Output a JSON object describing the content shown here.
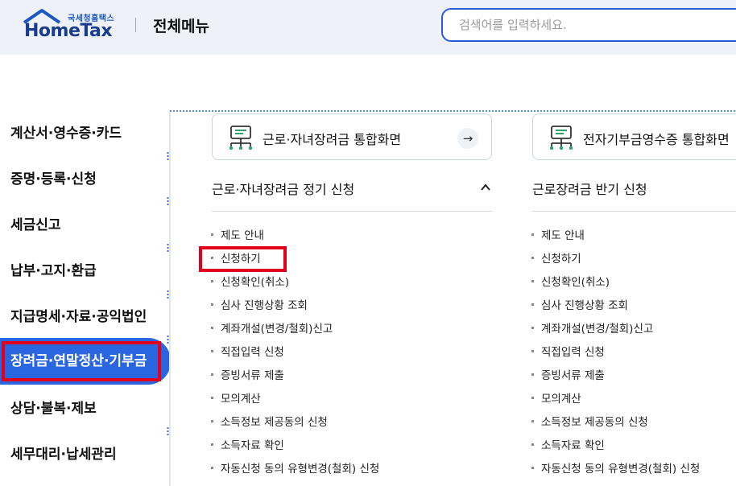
{
  "header": {
    "logo_small": "국세청홈택스",
    "logo_big": "HomeTax",
    "title": "전체메뉴",
    "search_placeholder": "검색어를 입력하세요."
  },
  "sidebar": {
    "items": [
      {
        "label": "계산서·영수증·카드",
        "active": false
      },
      {
        "label": "증명·등록·신청",
        "active": false
      },
      {
        "label": "세금신고",
        "active": false
      },
      {
        "label": "납부·고지·환급",
        "active": false
      },
      {
        "label": "지급명세·자료·공익법인",
        "active": false
      },
      {
        "label": "장려금·연말정산·기부금",
        "active": true
      },
      {
        "label": "상담·불복·제보",
        "active": false
      },
      {
        "label": "세무대리·납세관리",
        "active": false
      }
    ]
  },
  "cards": [
    {
      "label": "근로·자녀장려금 통합화면",
      "icon": "monitor-network-icon",
      "arrow": "→"
    },
    {
      "label": "전자기부금영수증 통합화면",
      "icon": "monitor-network-icon"
    }
  ],
  "sections": [
    {
      "title": "근로·자녀장려금 정기 신청",
      "expanded": true,
      "items": [
        "제도 안내",
        "신청하기",
        "신청확인(취소)",
        "심사 진행상황 조회",
        "계좌개설(변경/철회)신고",
        "직접입력 신청",
        "증빙서류 제출",
        "모의계산",
        "소득정보 제공동의 신청",
        "소득자료 확인",
        "자동신청 동의 유형변경(철회) 신청"
      ]
    },
    {
      "title": "근로장려금 반기 신청",
      "items": [
        "제도 안내",
        "신청하기",
        "신청확인(취소)",
        "심사 진행상황 조회",
        "계좌개설(변경/철회)신고",
        "직접입력 신청",
        "증빙서류 제출",
        "모의계산",
        "소득정보 제공동의 신청",
        "소득자료 확인",
        "자동신청 동의 유형변경(철회) 신청"
      ]
    }
  ],
  "colors": {
    "accent": "#2a66e0",
    "highlight": "#e0001b",
    "header_bg": "#eef2f8"
  }
}
